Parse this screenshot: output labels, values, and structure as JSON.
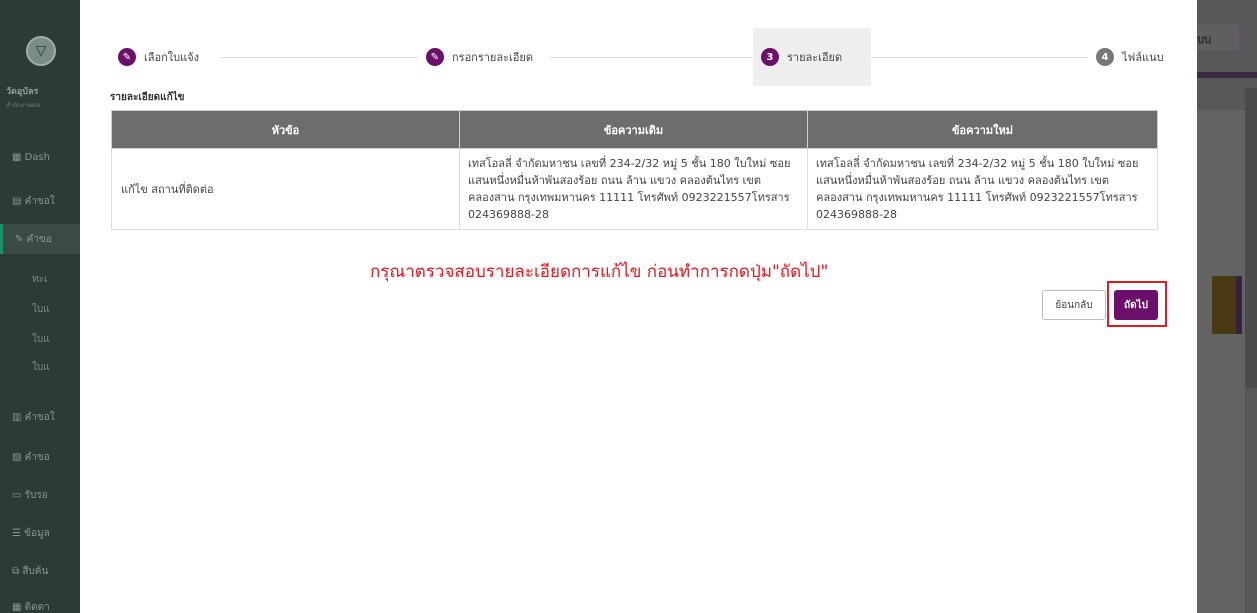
{
  "background": {
    "brand": "วัดอุบัลร",
    "brand_sub": "สำนักงานคณ",
    "menu": [
      "Dash",
      "คำขอใ",
      "คำขอ",
      "คำขอใ",
      "คำขอ",
      "รับรอ",
      "ข้อมูล",
      "สืบค้น",
      "ติดตา"
    ],
    "submenu": [
      "ทะเ",
      "ใบแ",
      "ใบแ",
      "ใบแ"
    ],
    "right_button": "บบ"
  },
  "stepper": {
    "steps": [
      {
        "label": "เลือกใบแจ้ง",
        "icon": "pencil-icon"
      },
      {
        "label": "กรอกรายละเอียด",
        "icon": "pencil-icon"
      },
      {
        "label": "รายละเอียด",
        "number": "3"
      },
      {
        "label": "ไฟล์แนบ",
        "number": "4"
      }
    ]
  },
  "section_title": "รายละเอียดแก้ไข",
  "table": {
    "headers": [
      "หัวข้อ",
      "ข้อความเดิม",
      "ข้อความใหม่"
    ],
    "rows": [
      {
        "topic": "แก้ไข สถานที่ติดต่อ",
        "old": "เทสโอลลี่ จำกัดมหาชน เลขที่ 234-2/32 หมู่ 5 ชั้น 180 ใบใหม่ ซอย แสนหนึ่งหมื่นห้าพันสองร้อย ถนน ล้าน แขวง คลองต้นไทร เขต คลองสาน กรุงเทพมหานคร 11111 โทรศัพท์ 0923221557โทรสาร 024369888-28",
        "new": "เทสโอลลี่ จำกัดมหาชน เลขที่ 234-2/32 หมู่ 5 ชั้น 180 ใบใหม่ ซอย แสนหนึ่งหมื่นห้าพันสองร้อย ถนน ล้าน แขวง คลองต้นไทร เขต คลองสาน กรุงเทพมหานคร 11111 โทรศัพท์ 0923221557โทรสาร 024369888-28"
      }
    ]
  },
  "warning": "กรุณาตรวจสอบรายละเอียดการแก้ไข ก่อนทำการกดปุ่ม\"ถัดไป\"",
  "buttons": {
    "back": "ย้อนกลับ",
    "next": "ถัดไป"
  },
  "colors": {
    "primary": "#6b0f6b",
    "warning": "#e8151b",
    "highlight": "#e31b23",
    "table_header": "#6d6d6d"
  }
}
